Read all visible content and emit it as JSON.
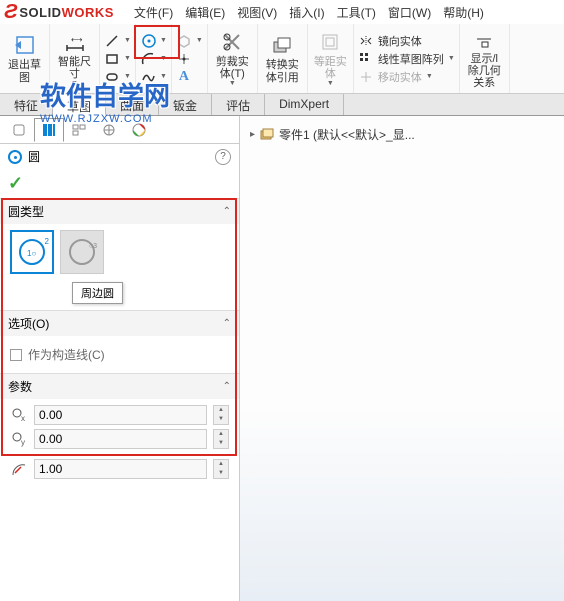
{
  "menubar": {
    "logo_solid": "SOLID",
    "logo_works": "WORKS",
    "items": [
      "文件(F)",
      "编辑(E)",
      "视图(V)",
      "插入(I)",
      "工具(T)",
      "窗口(W)",
      "帮助(H)"
    ]
  },
  "toolbar": {
    "exit_sketch": "退出草\n图",
    "smart_dim": "智能尺\n寸",
    "trim": "剪裁实\n体(T)",
    "convert": "转换实\n体引用",
    "offset": "等距实\n体",
    "mirror": "镜向实体",
    "pattern": "线性草图阵列",
    "move": "移动实体",
    "display": "显示/l\n除几何\n关系"
  },
  "tabs": {
    "items": [
      "特征",
      "草图",
      "曲面",
      "钣金",
      "评估",
      "DimXpert"
    ],
    "active": 1
  },
  "watermark": {
    "text": "软件自学网",
    "url": "WWW.RJZXW.COM"
  },
  "panel": {
    "title": "圆",
    "circle_type_header": "圆类型",
    "tooltip": "周边圆",
    "options_header": "选项(O)",
    "construction": "作为构造线(C)",
    "params_header": "参数",
    "cx": "0.00",
    "cy": "0.00",
    "r": "1.00"
  },
  "tree": {
    "item": "零件1  (默认<<默认>_显..."
  }
}
